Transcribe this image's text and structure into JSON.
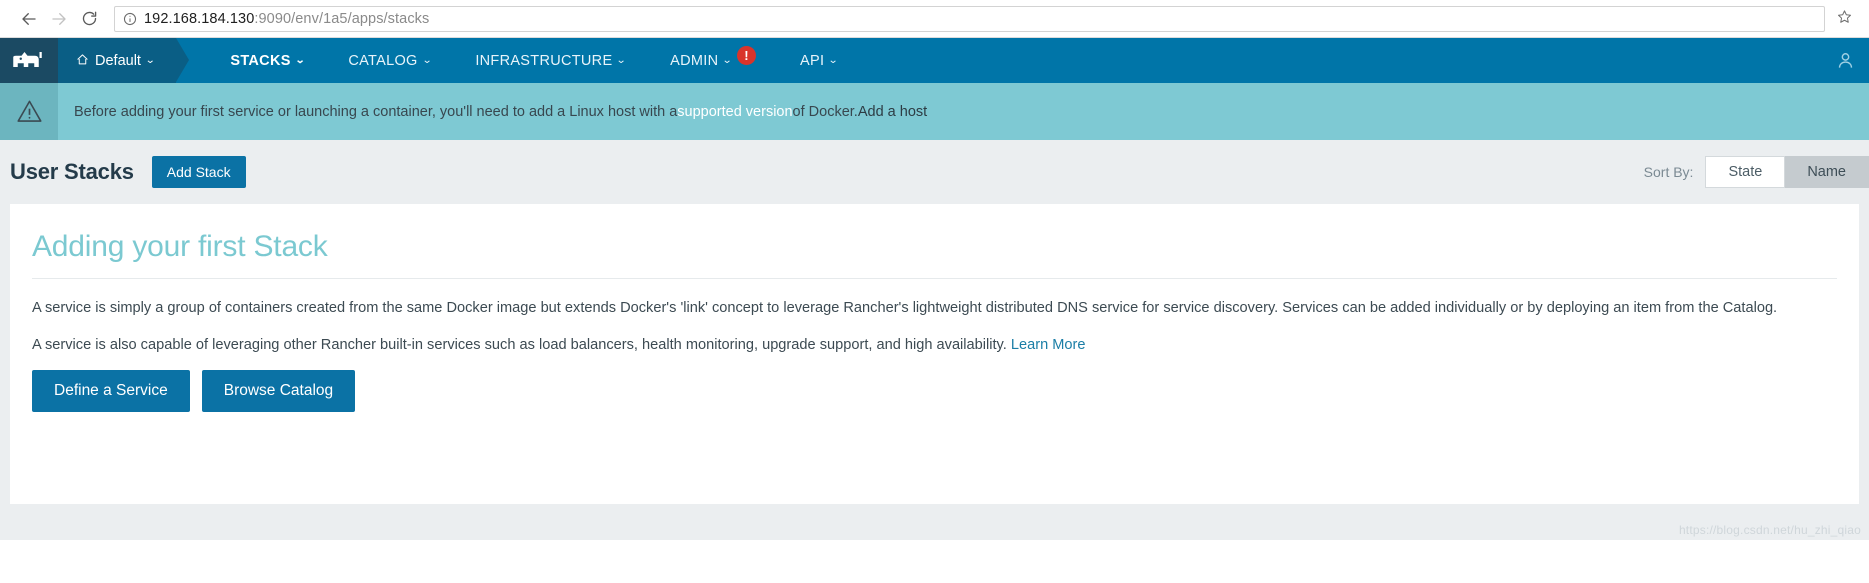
{
  "browser": {
    "back_icon": "back-arrow-icon",
    "forward_icon": "forward-arrow-icon",
    "reload_icon": "reload-icon",
    "info_icon": "site-info-icon",
    "bookmark_icon": "star-icon",
    "url_host": "192.168.184.130",
    "url_rest": ":9090/env/1a5/apps/stacks",
    "url_full": "192.168.184.130:9090/env/1a5/apps/stacks"
  },
  "topnav": {
    "logo_icon": "rancher-cow-logo",
    "environment": "Default",
    "home_icon": "home-icon",
    "items": [
      {
        "label": "STACKS",
        "active": true
      },
      {
        "label": "CATALOG",
        "active": false
      },
      {
        "label": "INFRASTRUCTURE",
        "active": false
      },
      {
        "label": "ADMIN",
        "active": false,
        "badge": "!"
      },
      {
        "label": "API",
        "active": false
      }
    ],
    "user_icon": "user-account-icon",
    "colors": {
      "bar": "#0075a8",
      "logo_cell": "#1b4a63",
      "env_cell": "#0a5e85",
      "badge": "#d9342b"
    }
  },
  "banner": {
    "icon": "warning-triangle-icon",
    "text_before": "Before adding your first service or launching a container, you'll need to add a Linux host with a ",
    "link1": "supported version",
    "text_middle": " of Docker. ",
    "link2": "Add a host",
    "color": "#7ec9d3"
  },
  "page": {
    "title": "User Stacks",
    "add_stack_label": "Add Stack",
    "sort_label": "Sort By:",
    "sort_options": [
      {
        "label": "State",
        "selected": false
      },
      {
        "label": "Name",
        "selected": true
      }
    ]
  },
  "card": {
    "title": "Adding your first Stack",
    "paragraph1": "A service is simply a group of containers created from the same Docker image but extends Docker's 'link' concept to leverage Rancher's lightweight distributed DNS service for service discovery. Services can be added individually or by deploying an item from the Catalog.",
    "paragraph2_text": "A service is also capable of leveraging other Rancher built-in services such as load balancers, health monitoring, upgrade support, and high availability. ",
    "paragraph2_link": "Learn More",
    "buttons": [
      {
        "label": "Define a Service"
      },
      {
        "label": "Browse Catalog"
      }
    ]
  },
  "watermark": {
    "text": "https://blog.csdn.net/hu_zhi_qiao"
  }
}
